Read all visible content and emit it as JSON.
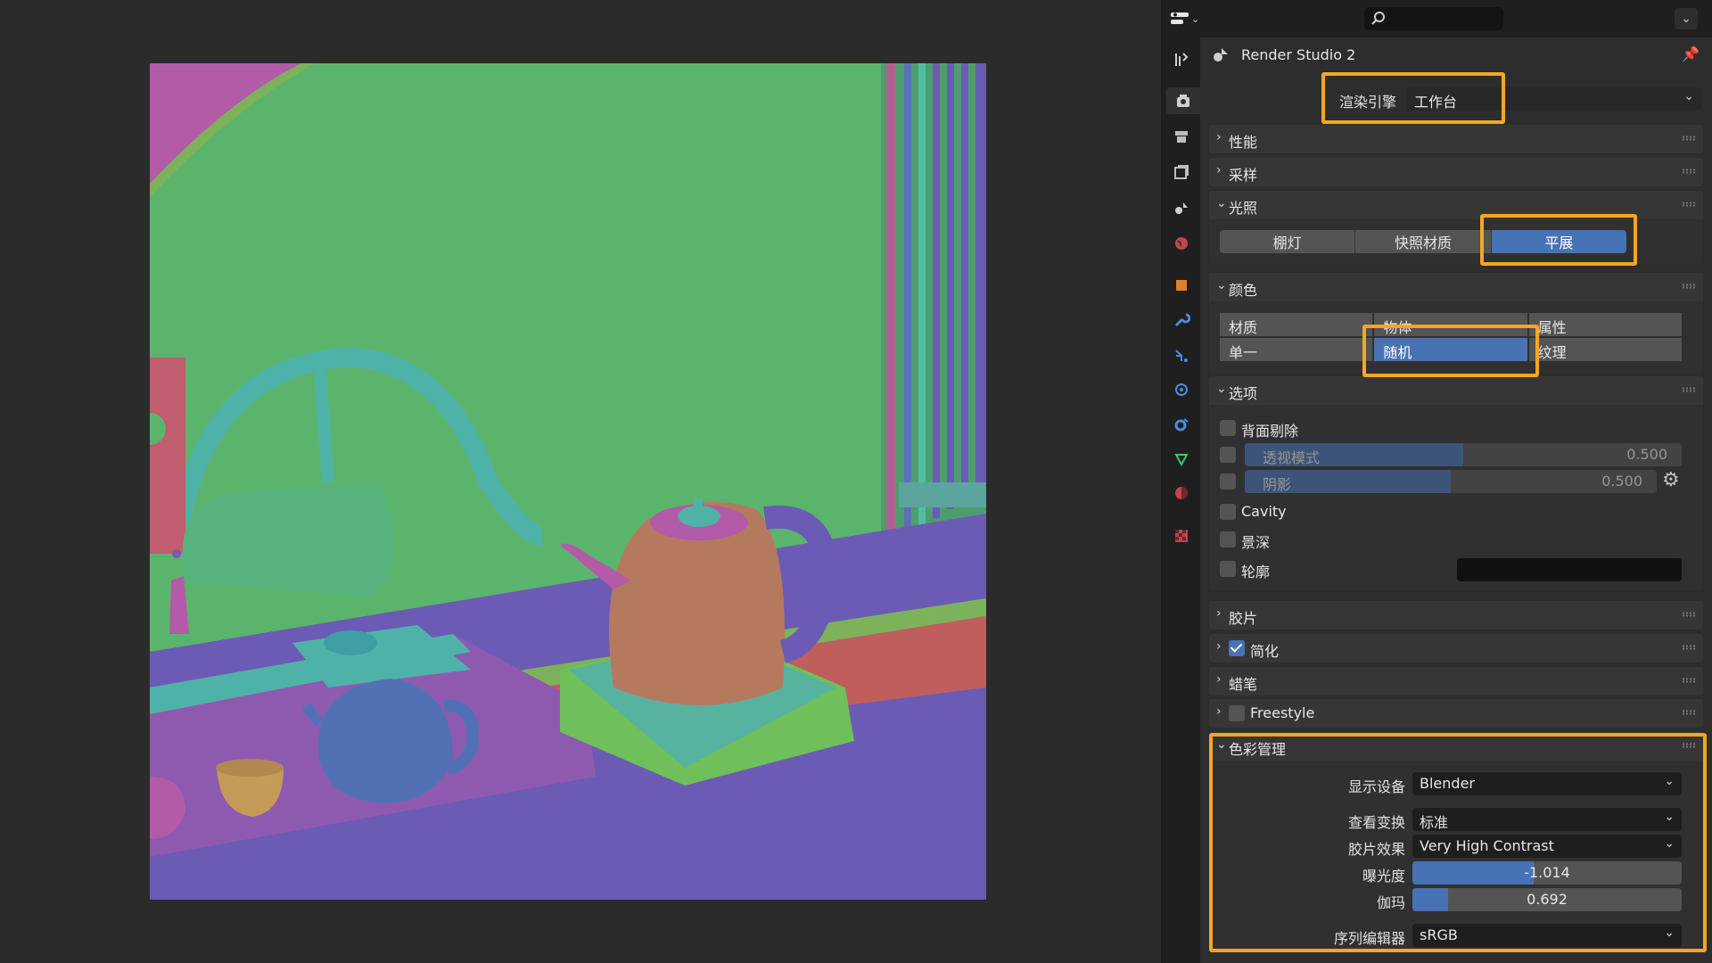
{
  "header": {
    "scene_title": "Render Studio 2"
  },
  "render": {
    "engine_label": "渲染引擎",
    "engine_value": "工作台"
  },
  "panels": {
    "performance": "性能",
    "sampling": "采样",
    "lighting": {
      "title": "光照",
      "options": [
        "棚灯",
        "快照材质",
        "平展"
      ],
      "selected": "平展"
    },
    "color": {
      "title": "颜色",
      "options": [
        "材质",
        "物体",
        "属性",
        "单一",
        "随机",
        "纹理"
      ],
      "selected": "随机"
    },
    "options": {
      "title": "选项",
      "backface_culling": "背面剔除",
      "xray_label": "透视模式",
      "xray_value": "0.500",
      "xray_fraction": 0.5,
      "shadow_label": "阴影",
      "shadow_value": "0.500",
      "shadow_fraction": 0.5,
      "cavity": "Cavity",
      "dof": "景深",
      "outline": "轮廓",
      "outline_color": "#111111"
    },
    "film": "胶片",
    "simplify": {
      "title": "简化",
      "checked": true
    },
    "grease_pencil": "蜡笔",
    "freestyle": {
      "title": "Freestyle",
      "checked": false
    },
    "color_management": {
      "title": "色彩管理",
      "display_device_label": "显示设备",
      "display_device_value": "Blender",
      "view_transform_label": "查看变换",
      "view_transform_value": "标准",
      "look_label": "胶片效果",
      "look_value": "Very High Contrast",
      "exposure_label": "曝光度",
      "exposure_value": "-1.014",
      "gamma_label": "伽玛",
      "gamma_value": "0.692",
      "sequencer_label": "序列编辑器",
      "sequencer_value": "sRGB"
    }
  },
  "colors": {
    "accent": "#4772b3",
    "highlight": "#f5a623"
  }
}
